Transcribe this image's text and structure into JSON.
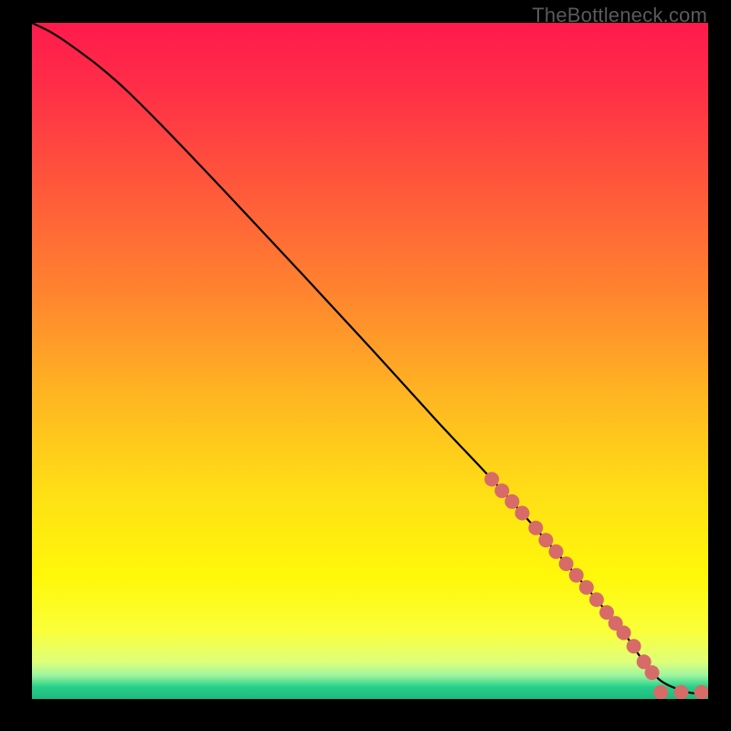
{
  "watermark": "TheBottleneck.com",
  "gradient": {
    "stops": [
      {
        "offset": 0.0,
        "color": "#ff1a4d"
      },
      {
        "offset": 0.1,
        "color": "#ff2f47"
      },
      {
        "offset": 0.25,
        "color": "#ff5a3a"
      },
      {
        "offset": 0.4,
        "color": "#ff842f"
      },
      {
        "offset": 0.55,
        "color": "#ffb522"
      },
      {
        "offset": 0.7,
        "color": "#ffe015"
      },
      {
        "offset": 0.82,
        "color": "#fff80a"
      },
      {
        "offset": 0.9,
        "color": "#faff3a"
      },
      {
        "offset": 0.945,
        "color": "#dfff7a"
      },
      {
        "offset": 0.965,
        "color": "#9ef5a0"
      },
      {
        "offset": 0.982,
        "color": "#26d08a"
      },
      {
        "offset": 1.0,
        "color": "#1fb87d"
      }
    ]
  },
  "chart_data": {
    "type": "line",
    "title": "",
    "xlabel": "",
    "ylabel": "",
    "xlim": [
      0,
      100
    ],
    "ylim": [
      0,
      100
    ],
    "series": [
      {
        "name": "curve",
        "x": [
          0,
          3,
          6,
          10,
          14,
          20,
          30,
          40,
          50,
          60,
          68,
          76,
          82,
          87.5,
          90,
          93,
          97,
          100
        ],
        "y": [
          100,
          98.5,
          96.5,
          93.5,
          90,
          84,
          73.5,
          62.8,
          52,
          41,
          32.5,
          23.5,
          16.5,
          9.8,
          6.2,
          2.7,
          1.0,
          0.8
        ]
      }
    ],
    "markers": {
      "name": "dots",
      "color": "#d76b67",
      "radius_px": 8,
      "points": [
        {
          "x": 68.0,
          "y": 32.5
        },
        {
          "x": 69.5,
          "y": 30.8
        },
        {
          "x": 71.0,
          "y": 29.2
        },
        {
          "x": 72.5,
          "y": 27.5
        },
        {
          "x": 74.5,
          "y": 25.3
        },
        {
          "x": 76.0,
          "y": 23.5
        },
        {
          "x": 77.5,
          "y": 21.8
        },
        {
          "x": 79.0,
          "y": 20.0
        },
        {
          "x": 80.5,
          "y": 18.3
        },
        {
          "x": 82.0,
          "y": 16.5
        },
        {
          "x": 83.5,
          "y": 14.7
        },
        {
          "x": 85.0,
          "y": 12.8
        },
        {
          "x": 86.3,
          "y": 11.2
        },
        {
          "x": 87.5,
          "y": 9.8
        },
        {
          "x": 89.0,
          "y": 7.8
        },
        {
          "x": 90.5,
          "y": 5.5
        },
        {
          "x": 91.7,
          "y": 3.9
        },
        {
          "x": 93.0,
          "y": 1.0
        },
        {
          "x": 96.0,
          "y": 1.0
        },
        {
          "x": 99.0,
          "y": 1.0
        }
      ]
    }
  }
}
